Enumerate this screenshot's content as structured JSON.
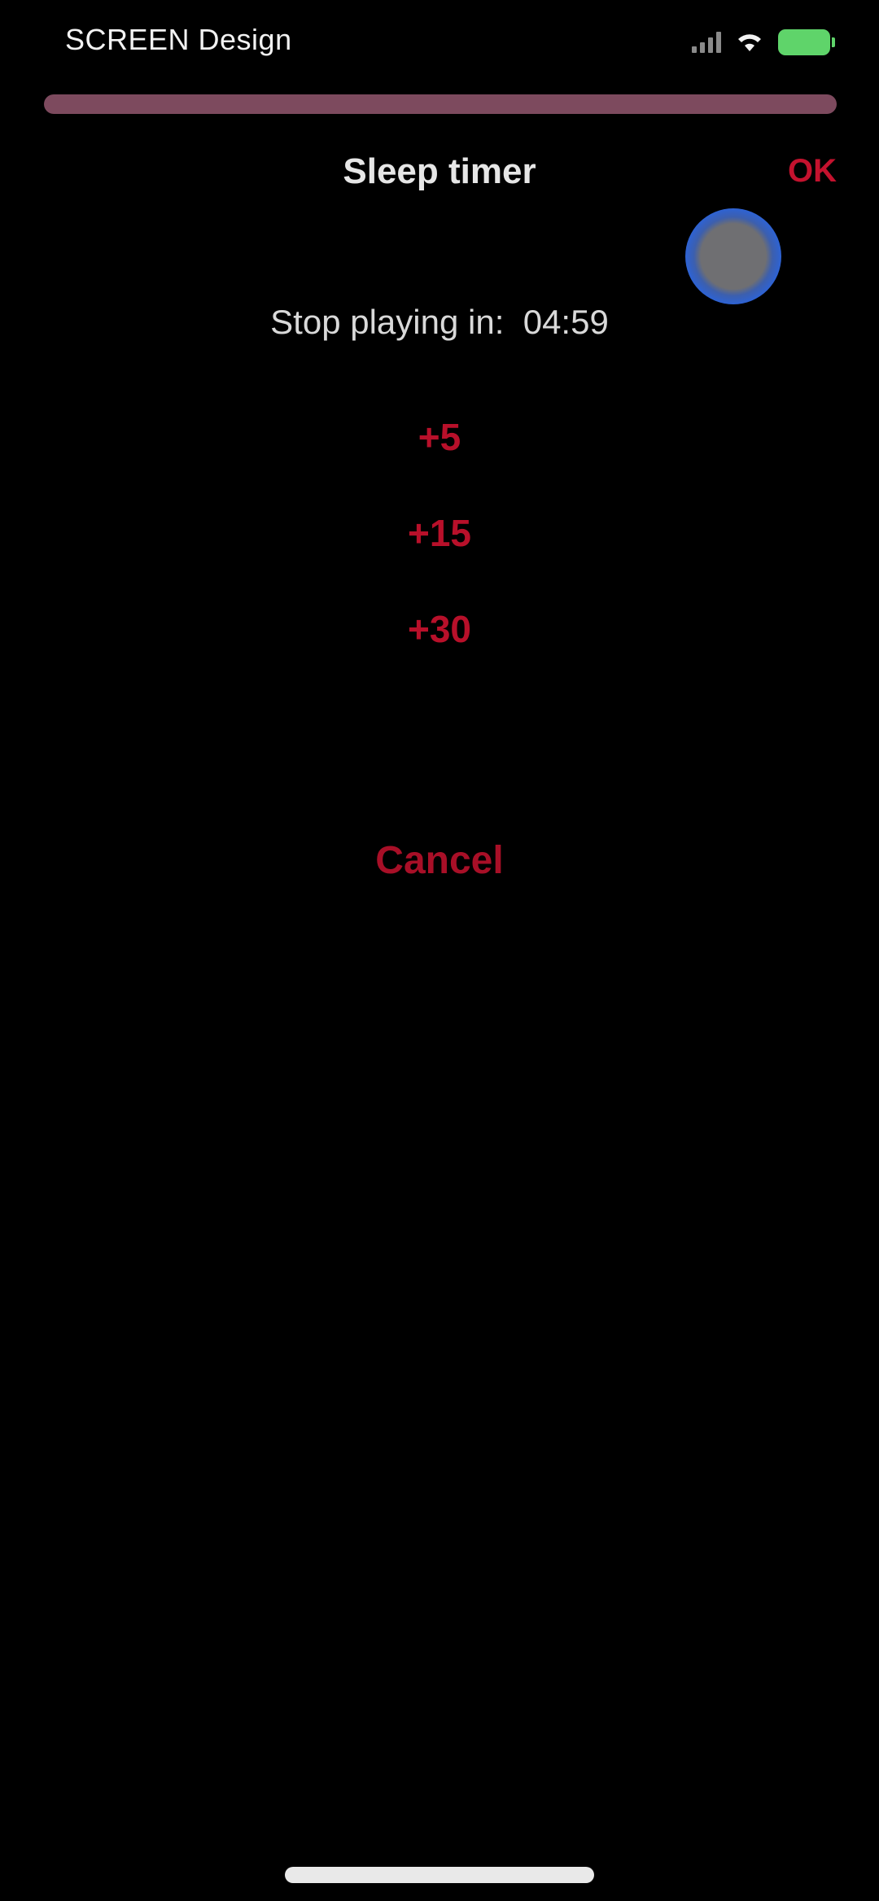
{
  "status_bar": {
    "left_text": "SCREEN Design",
    "icons": [
      "signal-icon",
      "wifi-icon",
      "battery-icon"
    ],
    "battery_color": "#5fd46a"
  },
  "sheet": {
    "title": "Sleep timer",
    "ok_label": "OK",
    "countdown_label": "Stop playing in",
    "countdown_value": "04:59",
    "increments": [
      "+5",
      "+15",
      "+30"
    ],
    "cancel_label": "Cancel"
  },
  "colors": {
    "accent": "#c4122e",
    "background": "#000000",
    "rule": "#7d4a5e"
  }
}
